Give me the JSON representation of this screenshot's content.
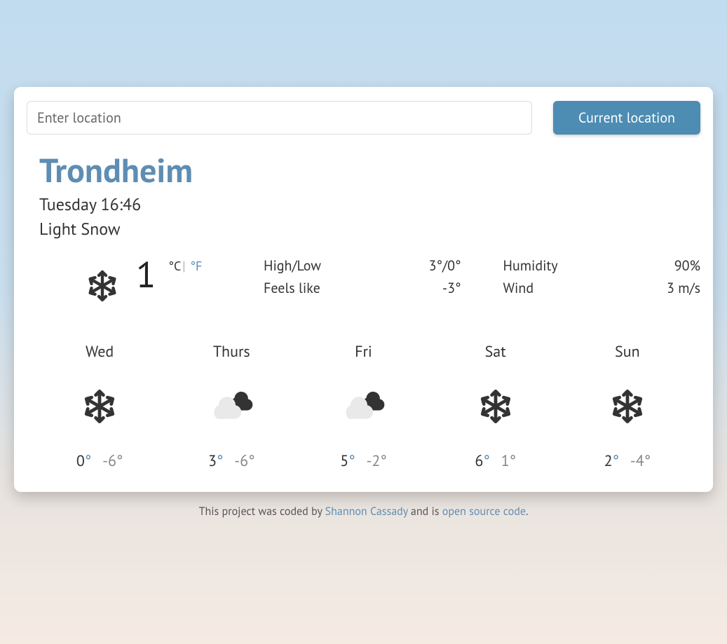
{
  "search": {
    "placeholder": "Enter location",
    "current_button": "Current location"
  },
  "location": {
    "name": "Trondheim",
    "datetime": "Tuesday 16:46",
    "condition": "Light Snow"
  },
  "current": {
    "temp": "1",
    "unit_c": "°C",
    "unit_sep": "|",
    "unit_f": "°F",
    "icon": "snowflake",
    "stats1": {
      "label_highlow": "High/Low",
      "label_feels": "Feels like",
      "value_highlow": "3°/0°",
      "value_feels": "-3°"
    },
    "stats2": {
      "label_humidity": "Humidity",
      "label_wind": "Wind",
      "value_humidity": "90%",
      "value_wind": "3 m/s"
    }
  },
  "forecast": [
    {
      "day": "Wed",
      "icon": "snowflake",
      "high": "0",
      "low": "-6°"
    },
    {
      "day": "Thurs",
      "icon": "cloud",
      "high": "3",
      "low": "-6°"
    },
    {
      "day": "Fri",
      "icon": "cloud",
      "high": "5",
      "low": "-2°"
    },
    {
      "day": "Sat",
      "icon": "snowflake",
      "high": "6",
      "low": "1°"
    },
    {
      "day": "Sun",
      "icon": "snowflake",
      "high": "2",
      "low": "-4°"
    }
  ],
  "footer": {
    "prefix": "This project was coded by ",
    "author": "Shannon Cassady",
    "mid": " and is ",
    "link": "open source code",
    "suffix": "."
  }
}
